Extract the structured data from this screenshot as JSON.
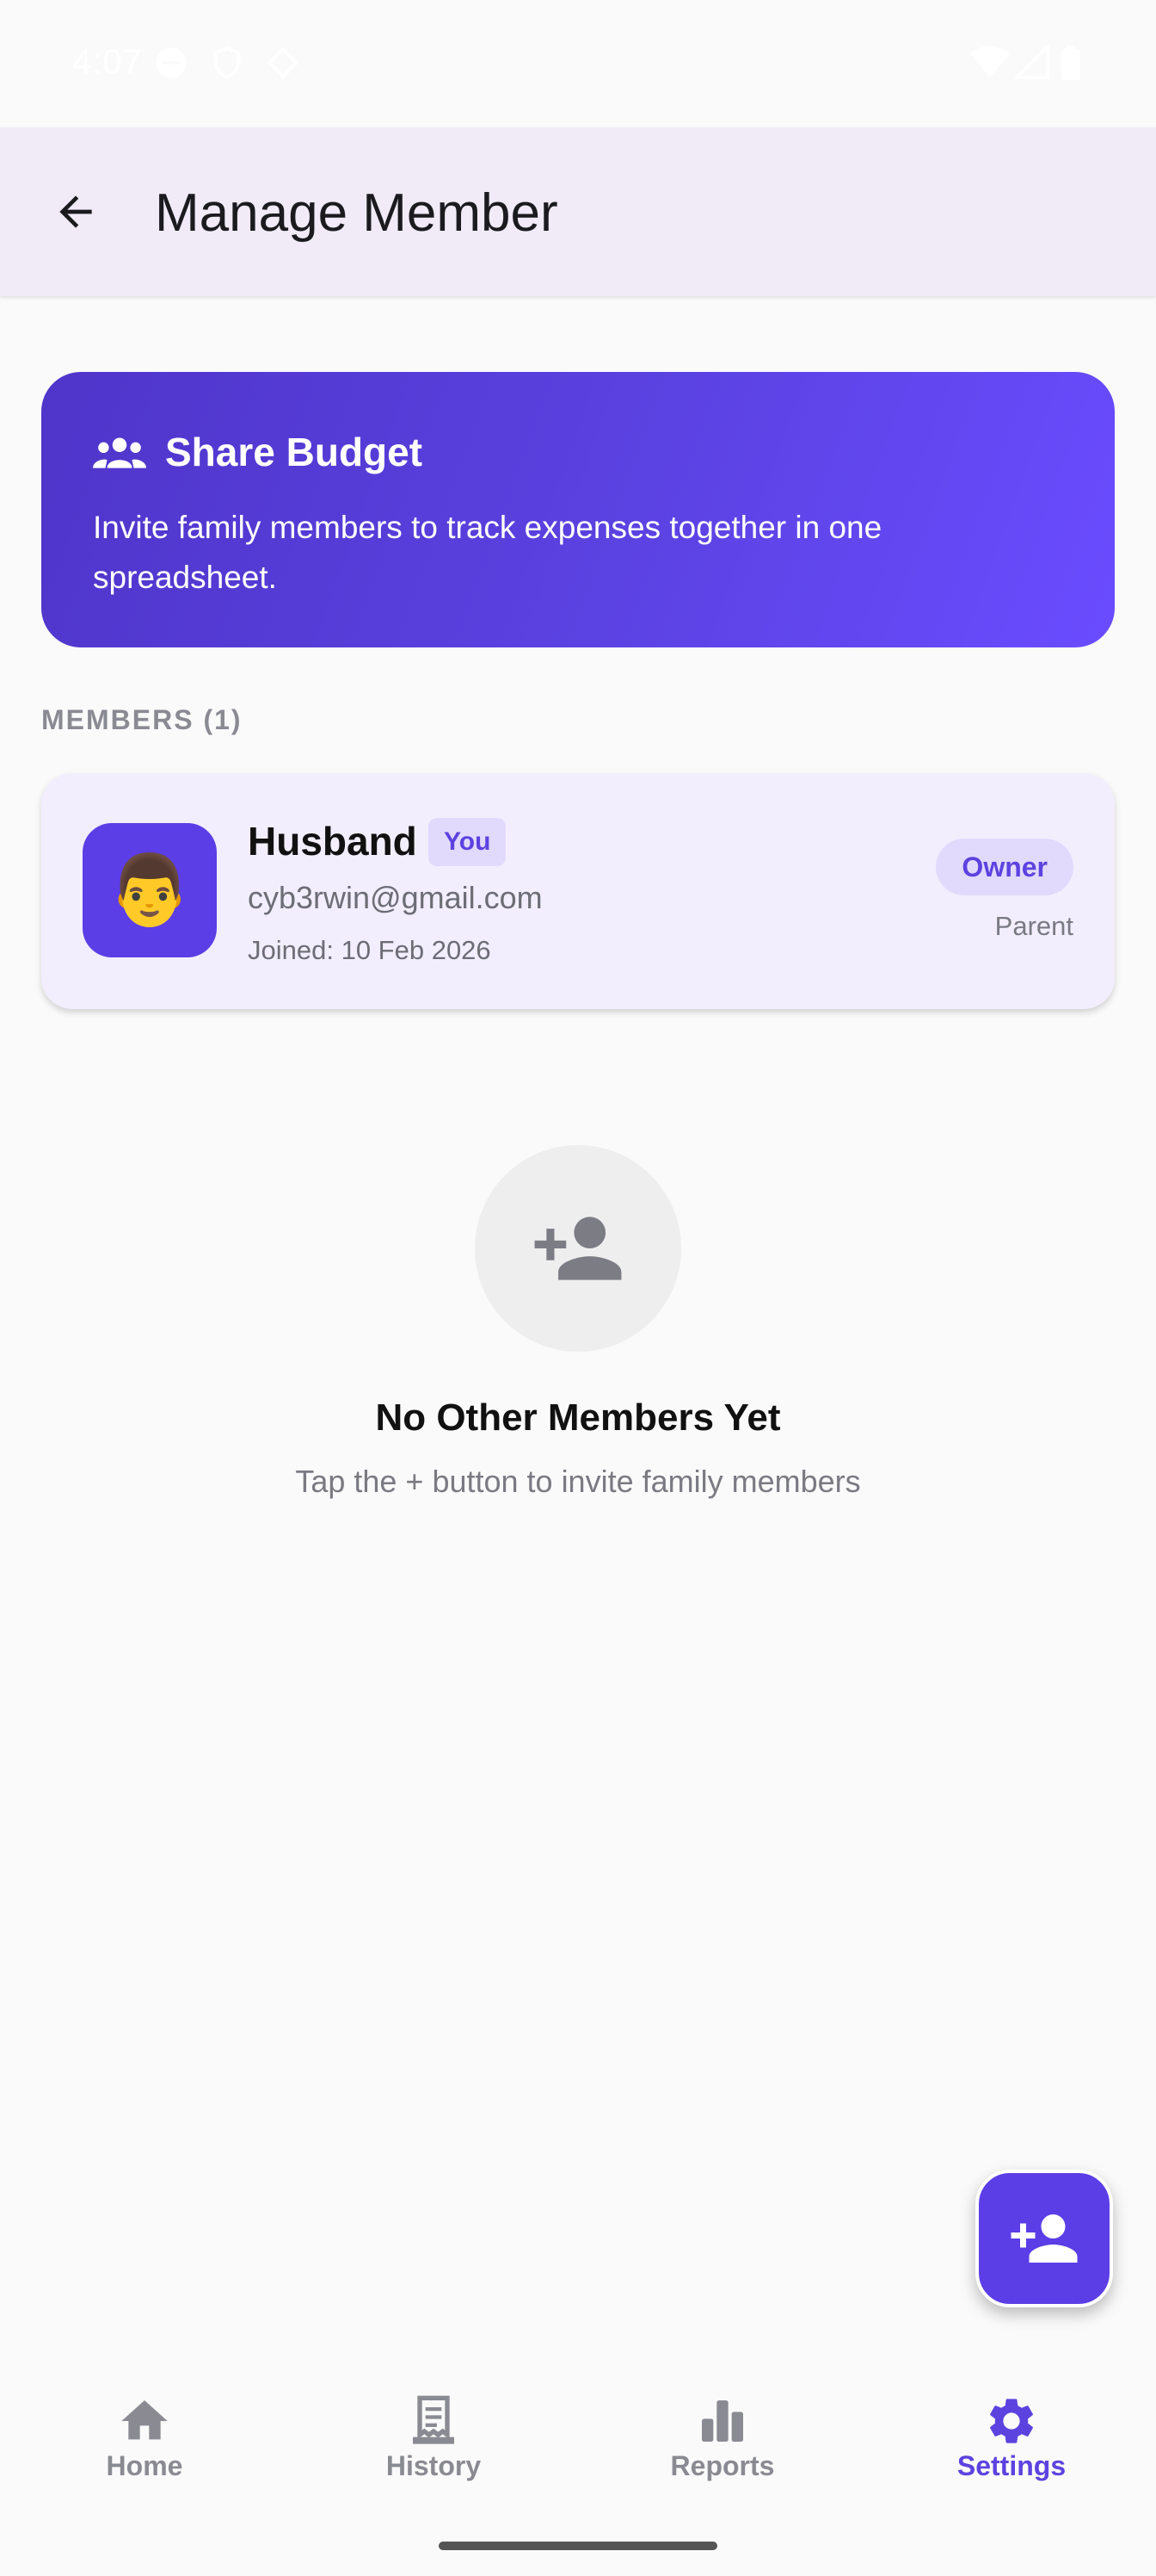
{
  "status_bar": {
    "time": "4:07"
  },
  "app_bar": {
    "title": "Manage Member"
  },
  "banner": {
    "title": "Share Budget",
    "description": "Invite family members to track expenses together in one spreadsheet."
  },
  "members_section": {
    "label": "MEMBERS (1)"
  },
  "members": [
    {
      "name": "Husband",
      "you_badge": "You",
      "email": "cyb3rwin@gmail.com",
      "joined": "Joined: 10 Feb 2026",
      "role_badge": "Owner",
      "relation": "Parent",
      "avatar_emoji": "👨"
    }
  ],
  "empty_state": {
    "title": "No Other Members Yet",
    "subtitle": "Tap the + button to invite family members"
  },
  "bottom_nav": {
    "items": [
      {
        "label": "Home",
        "icon": "home-icon"
      },
      {
        "label": "History",
        "icon": "receipt-icon"
      },
      {
        "label": "Reports",
        "icon": "bar-chart-icon"
      },
      {
        "label": "Settings",
        "icon": "gear-icon",
        "active": true
      }
    ]
  },
  "colors": {
    "accent": "#5b3ee6",
    "accent_light": "#e2dafc",
    "app_bar_bg": "#f0ebf7"
  }
}
